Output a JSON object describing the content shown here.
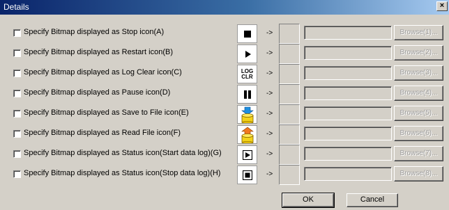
{
  "window": {
    "title": "Details",
    "close_label": "×"
  },
  "arrow": "->",
  "rows": [
    {
      "label": "Specify Bitmap displayed as Stop icon(A)",
      "icon": "stop-icon",
      "browse": "Browse(1)..."
    },
    {
      "label": "Specify Bitmap displayed as Restart icon(B)",
      "icon": "play-icon",
      "browse": "Browse(2)..."
    },
    {
      "label": "Specify Bitmap displayed as Log Clear icon(C)",
      "icon": "log-clear-icon",
      "icon_text": [
        "LOG",
        "CLR"
      ],
      "browse": "Browse(3)..."
    },
    {
      "label": "Specify Bitmap displayed as Pause icon(D)",
      "icon": "pause-icon",
      "browse": "Browse(4)..."
    },
    {
      "label": "Specify Bitmap displayed as Save to File icon(E)",
      "icon": "save-to-file-icon",
      "browse": "Browse(5)..."
    },
    {
      "label": "Specify Bitmap displayed as Read File icon(F)",
      "icon": "read-file-icon",
      "browse": "Browse(6)..."
    },
    {
      "label": "Specify Bitmap displayed as Status icon(Start data log)(G)",
      "icon": "status-start-icon",
      "browse": "Browse(7)..."
    },
    {
      "label": "Specify Bitmap displayed as Status icon(Stop data log)(H)",
      "icon": "status-stop-icon",
      "browse": "Browse(8)..."
    }
  ],
  "buttons": {
    "ok": "OK",
    "cancel": "Cancel"
  }
}
